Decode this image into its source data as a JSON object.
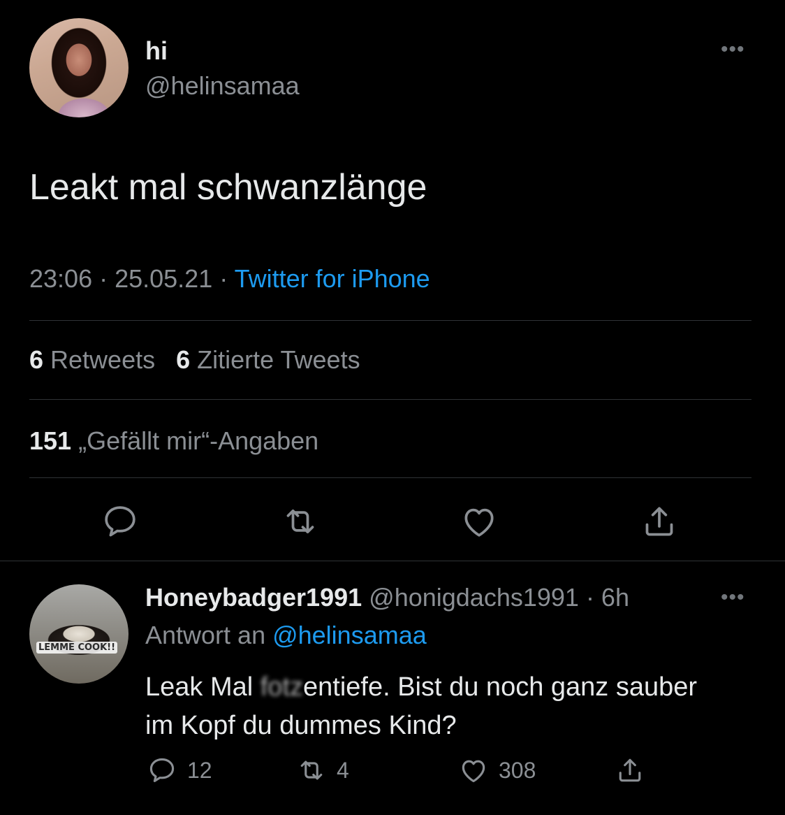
{
  "tweet": {
    "display_name": "hi",
    "handle": "@helinsamaa",
    "more_icon": "more-icon",
    "text": "Leakt mal schwanzlänge",
    "time": "23:06 · 25.05.21 · ",
    "source": "Twitter for iPhone",
    "retweets_count": "6",
    "retweets_label": " Retweets",
    "quotes_count": "6",
    "quotes_label": " Zitierte Tweets",
    "likes_count": "151",
    "likes_label": " „Gefällt mir“-Angaben"
  },
  "reply": {
    "display_name": "Honeybadger1991",
    "handle": " @honigdachs1991",
    "age": "· 6h",
    "avatar_caption": "LEMME COOK!!",
    "reply_to_prefix": "Antwort an ",
    "reply_to_handle": "@helinsamaa",
    "text_before": "Leak Mal ",
    "text_blurred": "fotz",
    "text_after": "entiefe. Bist du noch ganz sauber im Kopf du dummes Kind?",
    "reply_count": "12",
    "retweet_count": "4",
    "like_count": "308"
  },
  "colors": {
    "background": "#000000",
    "text": "#e7e9ea",
    "muted": "#8b8f94",
    "link": "#1d9bf0",
    "divider": "#2f3336"
  }
}
